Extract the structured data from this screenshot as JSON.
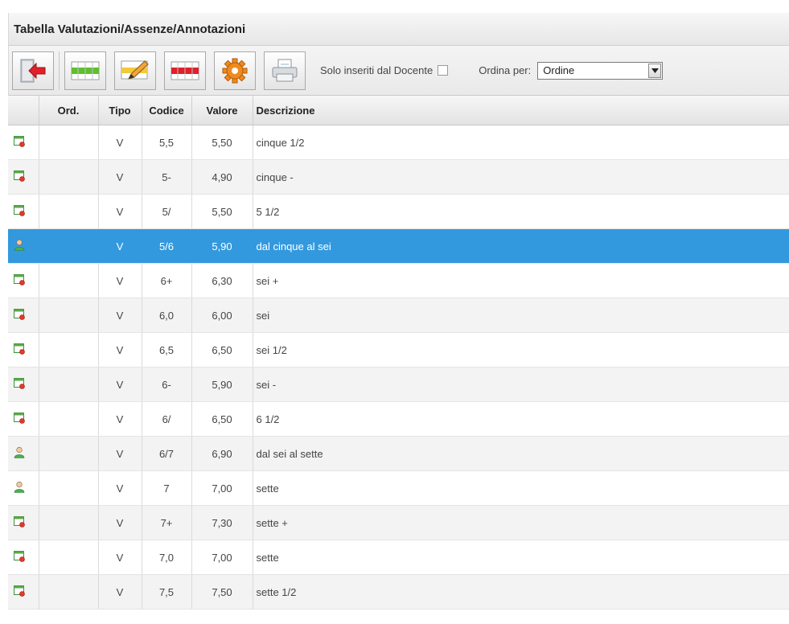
{
  "window": {
    "title": "Tabella Valutazioni/Assenze/Annotazioni"
  },
  "toolbar": {
    "buttons": [
      {
        "name": "exit-button",
        "icon": "exit-door-icon"
      },
      {
        "name": "add-row-button",
        "icon": "add-row-green-icon"
      },
      {
        "name": "edit-row-button",
        "icon": "edit-pencil-icon"
      },
      {
        "name": "delete-row-button",
        "icon": "delete-row-red-icon"
      },
      {
        "name": "settings-button",
        "icon": "gear-icon"
      },
      {
        "name": "print-button",
        "icon": "printer-icon"
      }
    ],
    "filter_label": "Solo inseriti dal Docente",
    "filter_checked": false,
    "order_label": "Ordina per:",
    "order_value": "Ordine"
  },
  "table": {
    "columns": [
      "",
      "Ord.",
      "Tipo",
      "Codice",
      "Valore",
      "Descrizione"
    ],
    "rows": [
      {
        "icon": "school-register-icon",
        "ord": "",
        "tipo": "V",
        "codice": "5,5",
        "valore": "5,50",
        "descrizione": "cinque 1/2"
      },
      {
        "icon": "school-register-icon",
        "ord": "",
        "tipo": "V",
        "codice": "5-",
        "valore": "4,90",
        "descrizione": "cinque -"
      },
      {
        "icon": "school-register-icon",
        "ord": "",
        "tipo": "V",
        "codice": "5/",
        "valore": "5,50",
        "descrizione": "5 1/2"
      },
      {
        "icon": "teacher-user-icon",
        "ord": "",
        "tipo": "V",
        "codice": "5/6",
        "valore": "5,90",
        "descrizione": "dal cinque al sei",
        "selected": true
      },
      {
        "icon": "school-register-icon",
        "ord": "",
        "tipo": "V",
        "codice": "6+",
        "valore": "6,30",
        "descrizione": "sei +"
      },
      {
        "icon": "school-register-icon",
        "ord": "",
        "tipo": "V",
        "codice": "6,0",
        "valore": "6,00",
        "descrizione": "sei"
      },
      {
        "icon": "school-register-icon",
        "ord": "",
        "tipo": "V",
        "codice": "6,5",
        "valore": "6,50",
        "descrizione": "sei 1/2"
      },
      {
        "icon": "school-register-icon",
        "ord": "",
        "tipo": "V",
        "codice": "6-",
        "valore": "5,90",
        "descrizione": "sei -"
      },
      {
        "icon": "school-register-icon",
        "ord": "",
        "tipo": "V",
        "codice": "6/",
        "valore": "6,50",
        "descrizione": "6 1/2"
      },
      {
        "icon": "teacher-user-icon",
        "ord": "",
        "tipo": "V",
        "codice": "6/7",
        "valore": "6,90",
        "descrizione": "dal sei al sette"
      },
      {
        "icon": "teacher-user-icon",
        "ord": "",
        "tipo": "V",
        "codice": "7",
        "valore": "7,00",
        "descrizione": "sette"
      },
      {
        "icon": "school-register-icon",
        "ord": "",
        "tipo": "V",
        "codice": "7+",
        "valore": "7,30",
        "descrizione": "sette +"
      },
      {
        "icon": "school-register-icon",
        "ord": "",
        "tipo": "V",
        "codice": "7,0",
        "valore": "7,00",
        "descrizione": "sette"
      },
      {
        "icon": "school-register-icon",
        "ord": "",
        "tipo": "V",
        "codice": "7,5",
        "valore": "7,50",
        "descrizione": "sette 1/2"
      }
    ]
  },
  "colors": {
    "selection": "#3399de",
    "alt_row": "#f3f3f3"
  }
}
